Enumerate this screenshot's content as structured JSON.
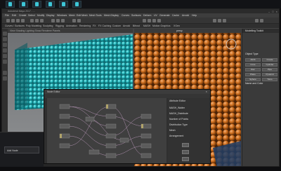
{
  "taskbar": {
    "apps": [
      "maya-icon-1",
      "maya-icon-2",
      "maya-icon-3",
      "maya-icon-4",
      "maya-icon-5",
      "maya-icon-6"
    ]
  },
  "window": {
    "title": "Autodesk Maya 2017 - ...",
    "menus": [
      "File",
      "Edit",
      "Create",
      "Select",
      "Modify",
      "Display",
      "Windows",
      "Mesh",
      "Edit Mesh",
      "Mesh Tools",
      "Mesh Display",
      "Curves",
      "Surfaces",
      "Deform",
      "UV",
      "Generate",
      "Cache",
      "Arnold",
      "Help"
    ],
    "shelf_tabs": [
      "Curves / Surfaces",
      "Poly Modeling",
      "Sculpting",
      "Rigging",
      "Animation",
      "Rendering",
      "FX",
      "FX Caching",
      "Custom",
      "Arnold",
      "Bifrost",
      "MASH",
      "Motion Graphics",
      "XGen"
    ]
  },
  "left_viewport": {
    "label": "View  Shading  Lighting  Show  Renderer  Panels"
  },
  "right_viewport": {
    "label": "persp"
  },
  "right_panel": {
    "header": "Modelling Toolkit",
    "section_title": "Object Type",
    "buttons": [
      "Attrib",
      "Create",
      "Cone",
      "Cylinder",
      "Disc",
      "Pipe",
      "Plane",
      "Pyramid",
      "Sphere",
      "Torus"
    ],
    "section2_title": "Name and Color"
  },
  "command_line": {
    "label": "MEL"
  },
  "node_editor": {
    "title": "Node Editor",
    "close_glyph": "×",
    "attr_header": "Attribute Editor",
    "attr_rows": [
      "MASH_Waiter",
      "MASH_Distribute",
      "Number of Points",
      "Distribution Type",
      "Mesh",
      "Arrangement"
    ]
  },
  "lower_left": {
    "button_label": "Add Node"
  }
}
